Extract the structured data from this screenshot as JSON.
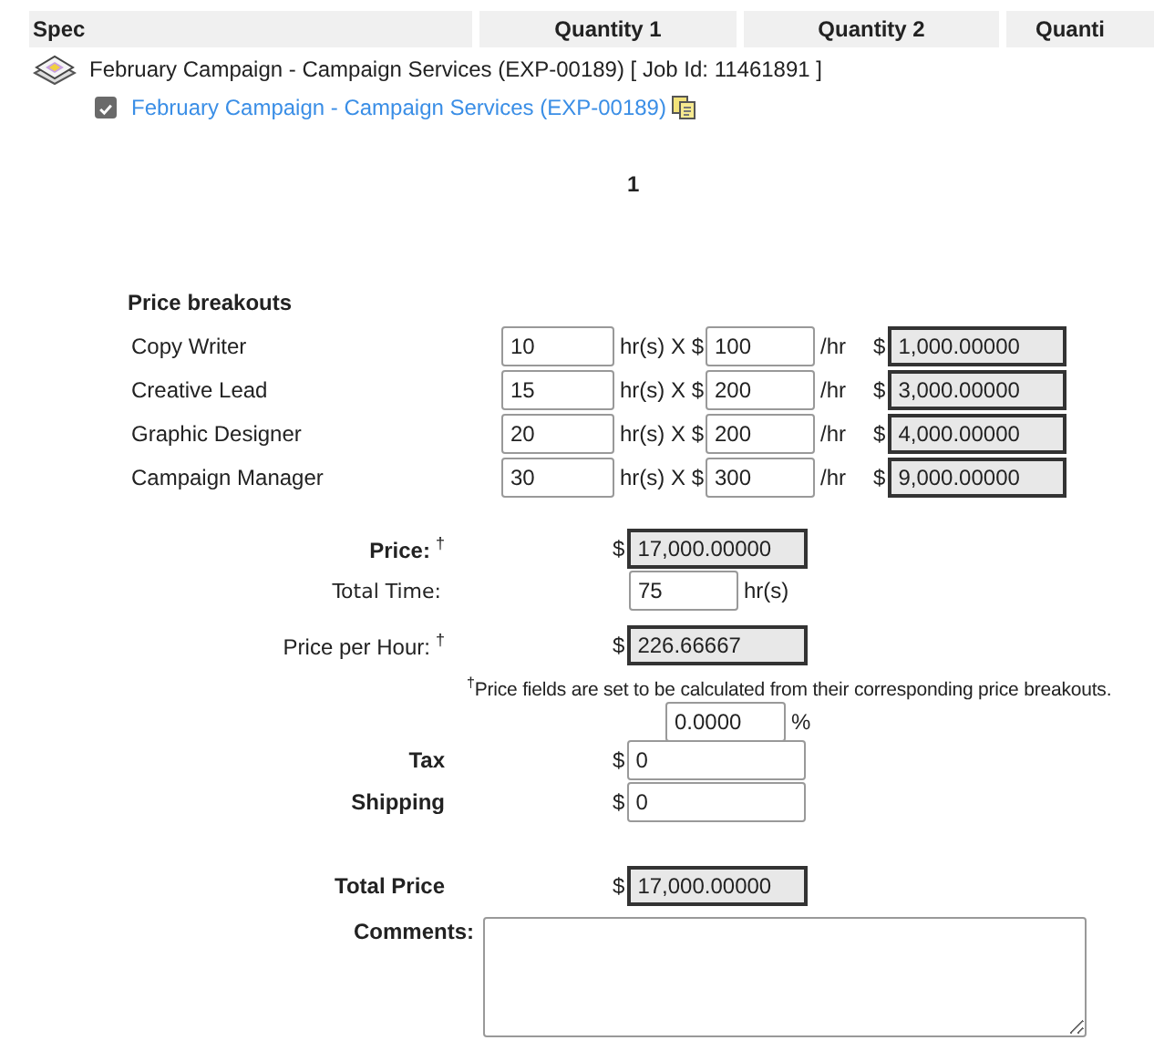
{
  "table": {
    "columns": [
      "Spec",
      "Quantity 1",
      "Quantity 2",
      "Quanti"
    ]
  },
  "job": {
    "title": "February Campaign - Campaign Services (EXP-00189) [ Job Id: 11461891 ]"
  },
  "spec": {
    "checked": true,
    "link": "February Campaign - Campaign Services (EXP-00189)"
  },
  "quantity_label": "1",
  "breakouts": {
    "title": "Price breakouts",
    "rows": [
      {
        "name": "Copy Writer",
        "hours": "10",
        "hours_unit": "hr(s) X $",
        "rate": "100",
        "rate_unit": "/hr",
        "currency": "$",
        "amount": "1,000.00000"
      },
      {
        "name": "Creative Lead",
        "hours": "15",
        "hours_unit": "hr(s) X $",
        "rate": "200",
        "rate_unit": "/hr",
        "currency": "$",
        "amount": "3,000.00000"
      },
      {
        "name": "Graphic Designer",
        "hours": "20",
        "hours_unit": "hr(s) X $",
        "rate": "200",
        "rate_unit": "/hr",
        "currency": "$",
        "amount": "4,000.00000"
      },
      {
        "name": "Campaign Manager",
        "hours": "30",
        "hours_unit": "hr(s) X $",
        "rate": "300",
        "rate_unit": "/hr",
        "currency": "$",
        "amount": "9,000.00000"
      }
    ]
  },
  "summary": [
    {
      "kind": "readonly",
      "label": "Price:",
      "bold": true,
      "mark": "†",
      "currency": "$",
      "value": "17,000.00000"
    },
    {
      "kind": "time",
      "label": "Total Time:",
      "bold": false,
      "value": "75",
      "unit": "hr(s)"
    },
    {
      "kind": "readonly",
      "label": "Price per Hour:",
      "bold": false,
      "mark": "†",
      "currency": "$",
      "value": "226.66667"
    },
    {
      "kind": "note",
      "text": "$^{†}$Price fields are set to be calculated from their corresponding price breakouts."
    },
    {
      "kind": "percent",
      "value": "0.0000",
      "unit": "%"
    },
    {
      "kind": "input",
      "label": "Tax",
      "bold": true,
      "currency": "$",
      "value": "0"
    },
    {
      "kind": "input",
      "label": "Shipping",
      "bold": true,
      "currency": "$",
      "value": "0"
    }
  ],
  "total": {
    "label": "Total Price",
    "currency": "$",
    "value": "17,000.00000"
  },
  "comments": {
    "label": "Comments:"
  }
}
